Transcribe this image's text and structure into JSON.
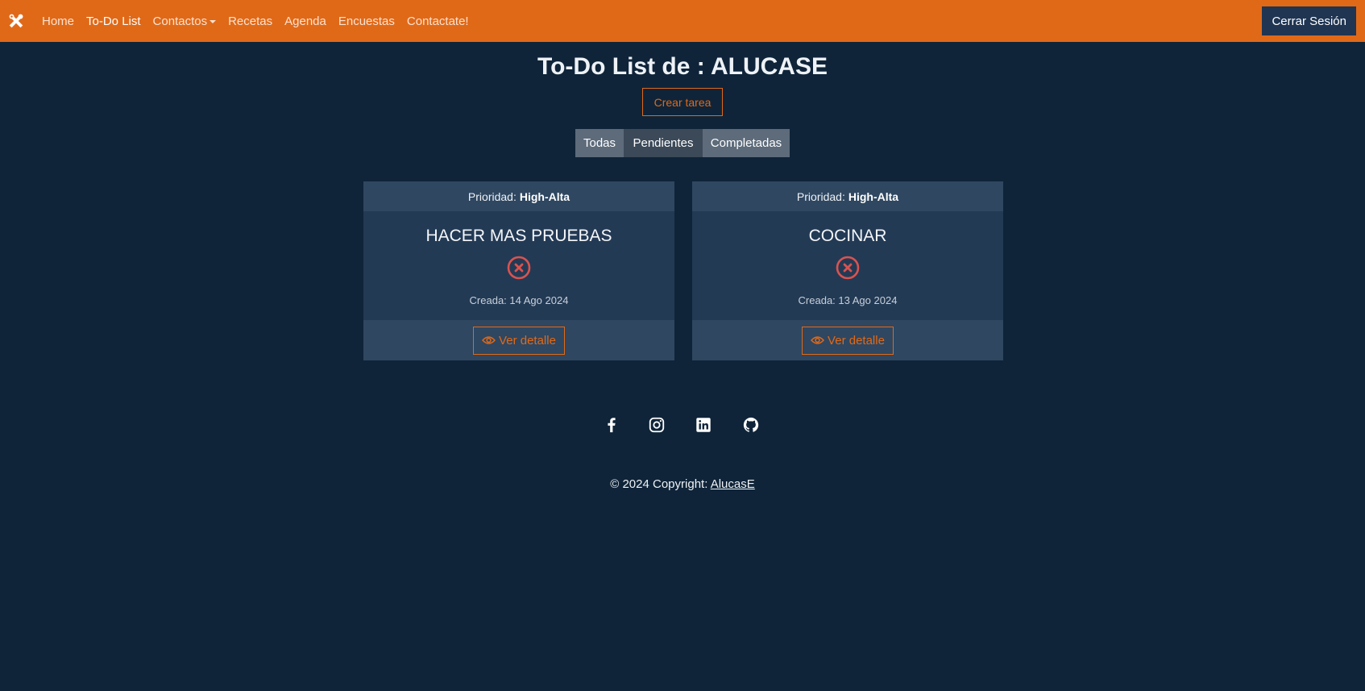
{
  "navbar": {
    "brand_icon": "tools-icon",
    "links": [
      {
        "label": "Home"
      },
      {
        "label": "To-Do List"
      },
      {
        "label": "Contactos"
      },
      {
        "label": "Recetas"
      },
      {
        "label": "Agenda"
      },
      {
        "label": "Encuestas"
      },
      {
        "label": "Contactate!"
      }
    ],
    "logout_label": "Cerrar Sesión",
    "color": "#e06918"
  },
  "page": {
    "title": "To-Do List de : ALUCASE",
    "create_label": "Crear tarea"
  },
  "filters": [
    "Todas",
    "Pendientes",
    "Completadas"
  ],
  "tasks": [
    {
      "priority_label": "Prioridad:",
      "priority": "High-Alta",
      "title": "HACER MAS PRUEBAS",
      "status_icon": "x-circle-icon",
      "created": "Creada: 14 Ago 2024",
      "detail_label": "Ver detalle"
    },
    {
      "priority_label": "Prioridad:",
      "priority": "High-Alta",
      "title": "COCINAR",
      "status_icon": "x-circle-icon",
      "created": "Creada: 13 Ago 2024",
      "detail_label": "Ver detalle"
    }
  ],
  "footer": {
    "social_icons": [
      "facebook-icon",
      "instagram-icon",
      "linkedin-icon",
      "github-icon"
    ],
    "copyright_text": "© 2024 Copyright: ",
    "copyright_link": "AlucasE"
  }
}
